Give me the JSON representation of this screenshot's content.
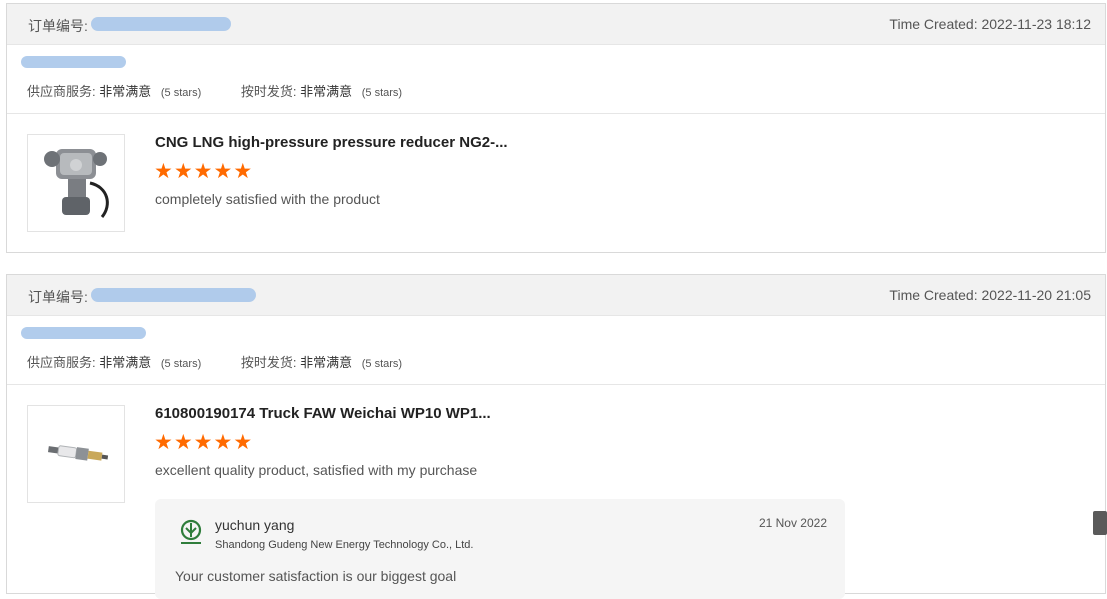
{
  "orders": [
    {
      "order_label": "订单编号:",
      "time_created": "Time Created: 2022-11-23 18:12",
      "ratings": [
        {
          "label": "供应商服务:",
          "value": "非常满意",
          "stars": "(5 stars)"
        },
        {
          "label": "按时发货:",
          "value": "非常满意",
          "stars": "(5 stars)"
        }
      ],
      "product": {
        "title": "CNG LNG high-pressure pressure reducer NG2-...",
        "rating_stars": 5,
        "review": "completely satisfied with the product",
        "image_icon": "pressure-reducer-image"
      }
    },
    {
      "order_label": "订单编号:",
      "time_created": "Time Created: 2022-11-20 21:05",
      "ratings": [
        {
          "label": "供应商服务:",
          "value": "非常满意",
          "stars": "(5 stars)"
        },
        {
          "label": "按时发货:",
          "value": "非常满意",
          "stars": "(5 stars)"
        }
      ],
      "product": {
        "title": "610800190174 Truck FAW Weichai WP10 WP1...",
        "rating_stars": 5,
        "review": "excellent quality product, satisfied with my purchase",
        "image_icon": "spark-plug-image"
      },
      "reply": {
        "name": "yuchun yang",
        "company": "Shandong Gudeng New Energy Technology Co., Ltd.",
        "date": "21 Nov 2022",
        "text": "Your customer satisfaction is our biggest goal",
        "logo_icon": "company-logo-icon"
      }
    }
  ],
  "colors": {
    "star": "#ff6a00",
    "header_bg": "#f2f2f2",
    "redaction": "#a9c6ea"
  },
  "star_glyph": "★"
}
